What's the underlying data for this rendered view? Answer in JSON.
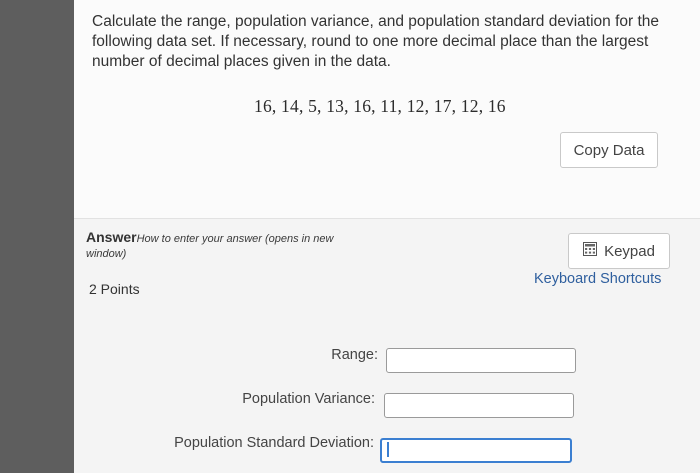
{
  "question": {
    "instruction": "Calculate the range, population variance, and population standard deviation for the following data set. If necessary, round to one more decimal place than the largest number of decimal places given in the data.",
    "data_set": "16, 14, 5, 13, 16, 11, 12, 17, 12, 16",
    "copy_button_label": "Copy Data"
  },
  "answer": {
    "label": "Answer",
    "help_link": "How to enter your answer (opens in new window)",
    "points": "2 Points",
    "keypad_label": "Keypad",
    "keypad_icon": "keypad-icon",
    "keyboard_shortcuts": "Keyboard Shortcuts",
    "fields": [
      {
        "label": "Range:",
        "value": ""
      },
      {
        "label": "Population Variance:",
        "value": ""
      },
      {
        "label": "Population Standard Deviation:",
        "value": ""
      }
    ]
  },
  "colors": {
    "link": "#2f5f9e",
    "focus": "#3b7fd1"
  }
}
